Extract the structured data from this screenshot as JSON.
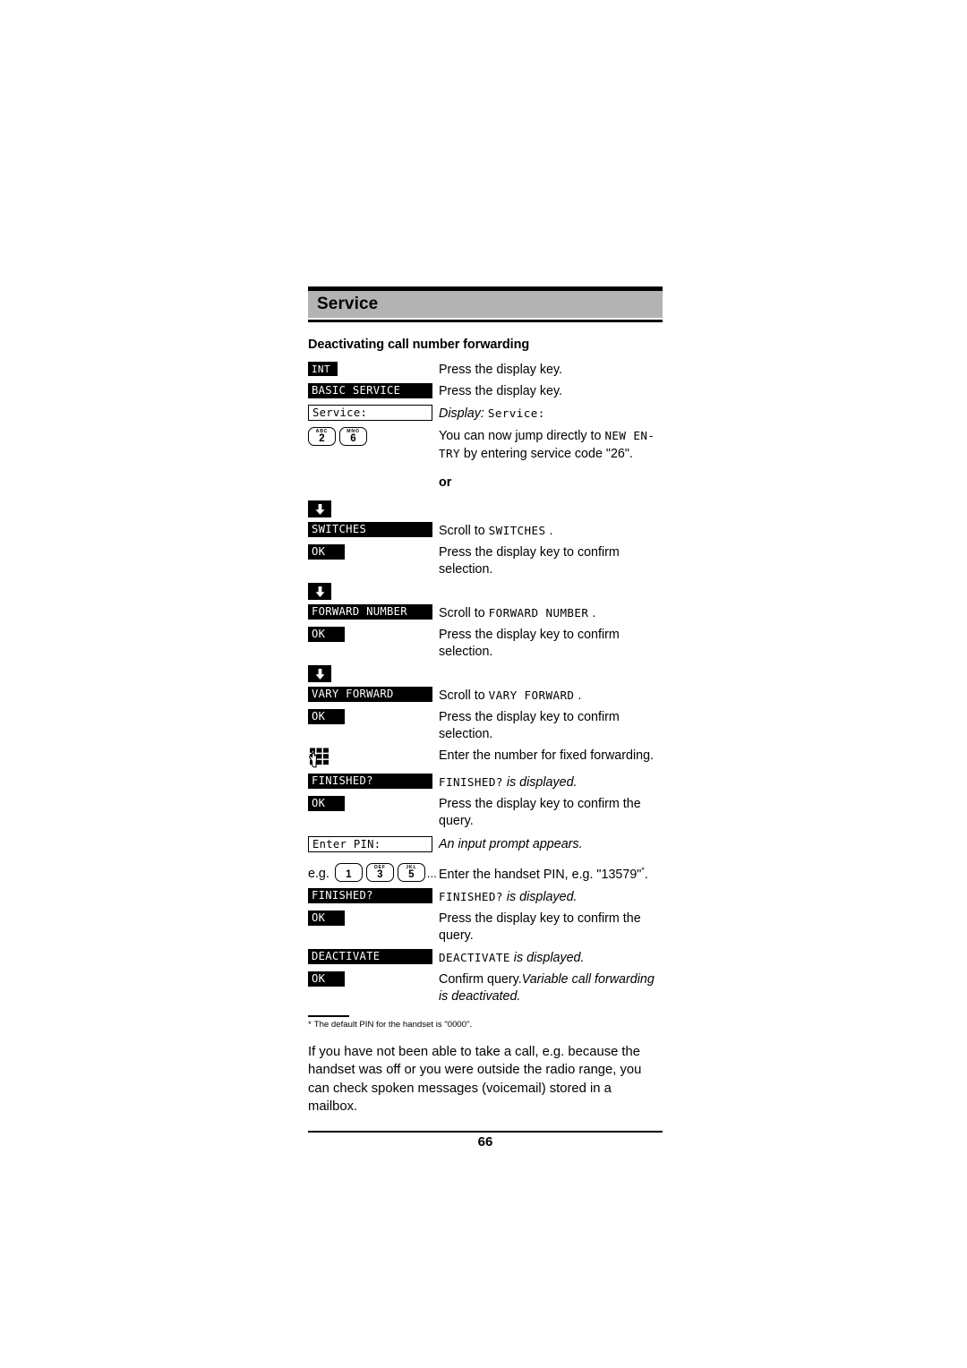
{
  "header": {
    "title": "Service"
  },
  "section": {
    "title": "Deactivating call number forwarding"
  },
  "steps": [
    {
      "key_label": "INT",
      "key_kind": "bar-tiny",
      "text": "Press the display key."
    },
    {
      "key_label": "BASIC SERVICE",
      "key_kind": "bar",
      "text": "Press the display key."
    },
    {
      "key_label": "Service:",
      "key_kind": "box",
      "text_prefix_italic": "Display:",
      "text_lcd": "Service:"
    },
    {
      "key_kind": "keys",
      "keys": [
        {
          "letters": "ABC",
          "digit": "2"
        },
        {
          "letters": "MNO",
          "digit": "6"
        }
      ],
      "text_part1": "You can now jump directly to ",
      "text_lcd1": "NEW EN-",
      "text_lcd2": "TRY",
      "text_part2": " by entering service code \"26\"."
    },
    {
      "key_kind": "or",
      "or_label": "or"
    },
    {
      "key_kind": "arrow",
      "icon": "down-arrow-icon"
    },
    {
      "key_label": "SWITCHES",
      "key_kind": "bar",
      "text_prefix": "Scroll to ",
      "text_lcd": "SWITCHES",
      "text_suffix": " ."
    },
    {
      "key_label": "OK",
      "key_kind": "bar-narrow",
      "text": "Press the display key to confirm selection."
    },
    {
      "key_kind": "arrow",
      "icon": "down-arrow-icon"
    },
    {
      "key_label": "FORWARD NUMBER",
      "key_kind": "bar",
      "text_prefix": "Scroll to ",
      "text_lcd": "FORWARD NUMBER",
      "text_suffix": " ."
    },
    {
      "key_label": "OK",
      "key_kind": "bar-narrow",
      "text": "Press the display key to confirm selection."
    },
    {
      "key_kind": "arrow",
      "icon": "down-arrow-icon"
    },
    {
      "key_label": "VARY FORWARD",
      "key_kind": "bar",
      "text_prefix": "Scroll to ",
      "text_lcd": "VARY FORWARD",
      "text_suffix": " ."
    },
    {
      "key_label": "OK",
      "key_kind": "bar-narrow",
      "text": "Press the display key to confirm selection."
    },
    {
      "key_kind": "keypad",
      "icon": "keypad-hand-icon",
      "text": "Enter the number for fixed forwarding."
    },
    {
      "key_label": "FINISHED?",
      "key_kind": "bar",
      "text_lcd": "FINISHED?",
      "text_italic": " is displayed."
    },
    {
      "key_label": "OK",
      "key_kind": "bar-narrow",
      "text": "Press the display key to confirm the query."
    },
    {
      "key_label": "Enter PIN:",
      "key_kind": "box",
      "text_italic_full": "An input prompt appears."
    },
    {
      "key_kind": "pin-keys",
      "eg_label": "e.g.",
      "keys": [
        {
          "letters": "",
          "digit": "1"
        },
        {
          "letters": "DEF",
          "digit": "3"
        },
        {
          "letters": "JKL",
          "digit": "5"
        }
      ],
      "trailing": "...",
      "text": "Enter the handset PIN, e.g. \"13579\"",
      "text_sup": "*",
      "text_end": "."
    },
    {
      "key_label": "FINISHED?",
      "key_kind": "bar",
      "text_lcd": "FINISHED?",
      "text_italic": " is displayed."
    },
    {
      "key_label": "OK",
      "key_kind": "bar-narrow",
      "text": "Press the display key to confirm the query."
    },
    {
      "key_label": "DEACTIVATE",
      "key_kind": "bar",
      "text_lcd": "DEACTIVATE",
      "text_italic": " is displayed."
    },
    {
      "key_label": "OK",
      "key_kind": "bar-narrow",
      "text_plain": "Confirm query.",
      "text_italic": "Variable call forwarding is deactivated."
    }
  ],
  "footnote": {
    "marker": "*",
    "text": "The default PIN for the handset is \"0000\"."
  },
  "closing": {
    "text": "If you have not been able to take a call, e.g. because the handset was off or you were outside the radio range, you can check spoken messages (voicemail) stored in a mailbox."
  },
  "footer": {
    "page_number": "66"
  },
  "colors": {
    "header_band": "#b3b3b3",
    "ink": "#000000",
    "paper": "#ffffff"
  }
}
